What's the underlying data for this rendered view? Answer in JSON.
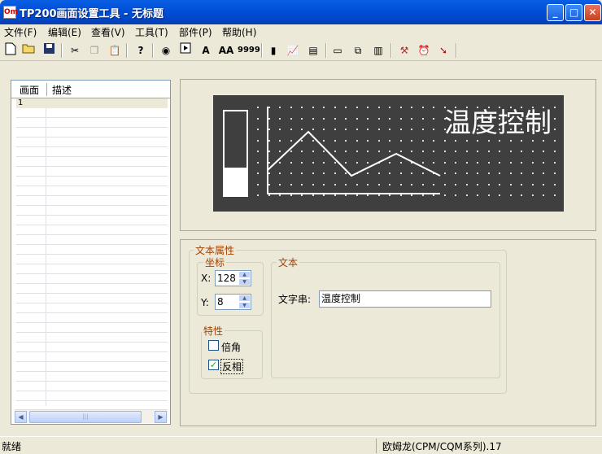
{
  "window": {
    "title": "TP200画面设置工具 - 无标题",
    "app_icon": "app-logo-icon"
  },
  "menu": [
    "文件(F)",
    "编辑(E)",
    "查看(V)",
    "工具(T)",
    "部件(P)",
    "帮助(H)"
  ],
  "toolbar": {
    "text_small": "A",
    "text_large": "AA",
    "numeric": "9999"
  },
  "screen_list": {
    "headers": {
      "screen": "画面",
      "description": "描述"
    },
    "rows": [
      {
        "screen": "1",
        "description": ""
      }
    ],
    "scroll_thumb": "|||"
  },
  "preview": {
    "lcd_text": "温度控制",
    "lcd_bg": "#3f3f3f",
    "lcd_fg": "#ffffff",
    "bar_level": 0.33
  },
  "props": {
    "group_title": "文本属性",
    "coord": {
      "title": "坐标",
      "x_label": "X:",
      "x_value": "128",
      "y_label": "Y:",
      "y_value": "8"
    },
    "traits": {
      "title": "特性",
      "double": {
        "label": "倍角",
        "checked": false
      },
      "invert": {
        "label": "反相",
        "checked": true
      }
    },
    "text": {
      "title": "文本",
      "string_label": "文字串:",
      "string_value": "温度控制"
    }
  },
  "status": {
    "left": "就绪",
    "right": "欧姆龙(CPM/CQM系列).17"
  }
}
